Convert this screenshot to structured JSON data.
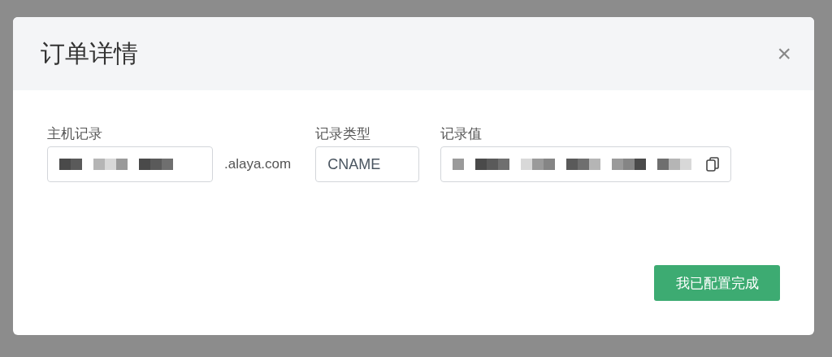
{
  "dialog": {
    "title": "订单详情",
    "close": "×",
    "fields": [
      {
        "kind": "host",
        "label": "主机记录",
        "suffix": ".alaya.com"
      },
      {
        "kind": "text",
        "label": "记录类型",
        "value": "CNAME"
      },
      {
        "kind": "copy",
        "label": "记录值"
      }
    ],
    "button": "我已配置完成"
  }
}
